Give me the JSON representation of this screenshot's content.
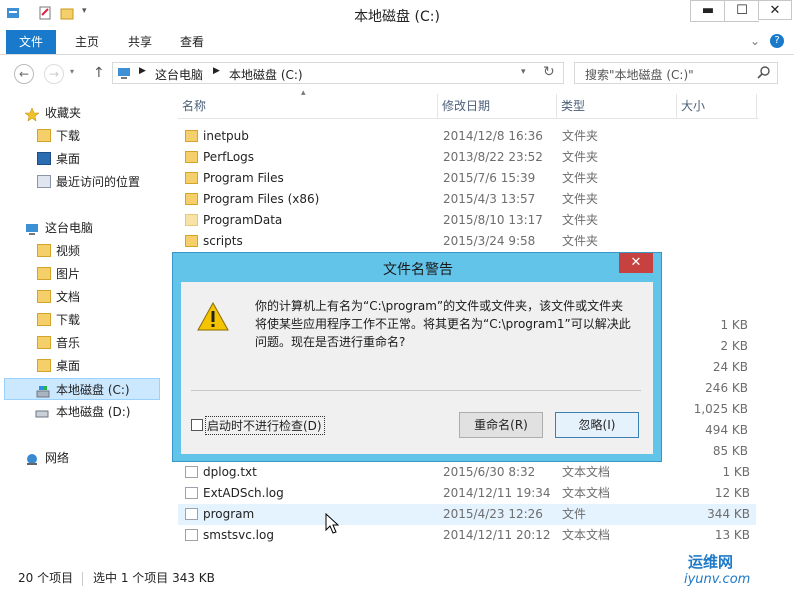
{
  "window": {
    "title": "本地磁盘 (C:)",
    "buttons": {
      "minimize": "▬",
      "maximize": "☐",
      "close": "✕"
    }
  },
  "ribbon": {
    "tabs": [
      {
        "label": "文件"
      },
      {
        "label": "主页"
      },
      {
        "label": "共享"
      },
      {
        "label": "查看"
      }
    ],
    "expand_glyph": "⌄",
    "help_glyph": "?"
  },
  "address": {
    "path": [
      "这台电脑",
      "本地磁盘 (C:)"
    ],
    "search_placeholder": "搜索\"本地磁盘 (C:)\""
  },
  "nav": {
    "items": [
      {
        "label": "收藏夹",
        "icon": "star-icon"
      },
      {
        "label": "下载",
        "icon": "folder-download-icon"
      },
      {
        "label": "桌面",
        "icon": "desktop-icon"
      },
      {
        "label": "最近访问的位置",
        "icon": "recent-places-icon"
      },
      {
        "label": "这台电脑",
        "icon": "computer-icon"
      },
      {
        "label": "视频",
        "icon": "folder-icon"
      },
      {
        "label": "图片",
        "icon": "folder-icon"
      },
      {
        "label": "文档",
        "icon": "folder-icon"
      },
      {
        "label": "下载",
        "icon": "folder-icon"
      },
      {
        "label": "音乐",
        "icon": "folder-icon"
      },
      {
        "label": "桌面",
        "icon": "folder-icon"
      },
      {
        "label": "本地磁盘 (C:)",
        "icon": "drive-icon"
      },
      {
        "label": "本地磁盘 (D:)",
        "icon": "drive-icon"
      },
      {
        "label": "网络",
        "icon": "network-icon"
      }
    ]
  },
  "columns": {
    "name": "名称",
    "modified": "修改日期",
    "type": "类型",
    "size": "大小"
  },
  "files_top": [
    {
      "name": "inetpub",
      "date": "2014/12/8 16:36",
      "type": "文件夹",
      "size": ""
    },
    {
      "name": "PerfLogs",
      "date": "2013/8/22 23:52",
      "type": "文件夹",
      "size": ""
    },
    {
      "name": "Program Files",
      "date": "2015/7/6 15:39",
      "type": "文件夹",
      "size": ""
    },
    {
      "name": "Program Files (x86)",
      "date": "2015/4/3 13:57",
      "type": "文件夹",
      "size": ""
    },
    {
      "name": "ProgramData",
      "date": "2015/8/10 13:17",
      "type": "文件夹",
      "size": ""
    },
    {
      "name": "scripts",
      "date": "2015/3/24 9:58",
      "type": "文件夹",
      "size": ""
    }
  ],
  "hidden_sizes": [
    "1 KB",
    "2 KB",
    "24 KB",
    "246 KB",
    "1,025 KB",
    "494 KB",
    "85 KB"
  ],
  "files_bottom": [
    {
      "name": "dplog.txt",
      "date": "2015/6/30 8:32",
      "type": "文本文档",
      "size": "1 KB"
    },
    {
      "name": "ExtADSch.log",
      "date": "2014/12/11 19:34",
      "type": "文本文档",
      "size": "12 KB"
    },
    {
      "name": "program",
      "date": "2015/4/23 12:26",
      "type": "文件",
      "size": "344 KB"
    },
    {
      "name": "smstsvc.log",
      "date": "2014/12/11 20:12",
      "type": "文本文档",
      "size": "13 KB"
    }
  ],
  "dialog": {
    "title": "文件名警告",
    "message": "你的计算机上有名为“C:\\program”的文件或文件夹，该文件或文件夹将使某些应用程序工作不正常。将其更名为“C:\\program1”可以解决此问题。现在是否进行重命名?",
    "checkbox_label": "启动时不进行检查(D)",
    "rename_button": "重命名(R)",
    "ignore_button": "忽略(I)",
    "close_glyph": "✕"
  },
  "status": {
    "item_count": "20 个项目",
    "selection": "选中 1 个项目 343 KB"
  },
  "watermark": {
    "text": "运维网",
    "url": "iyunv.com"
  }
}
